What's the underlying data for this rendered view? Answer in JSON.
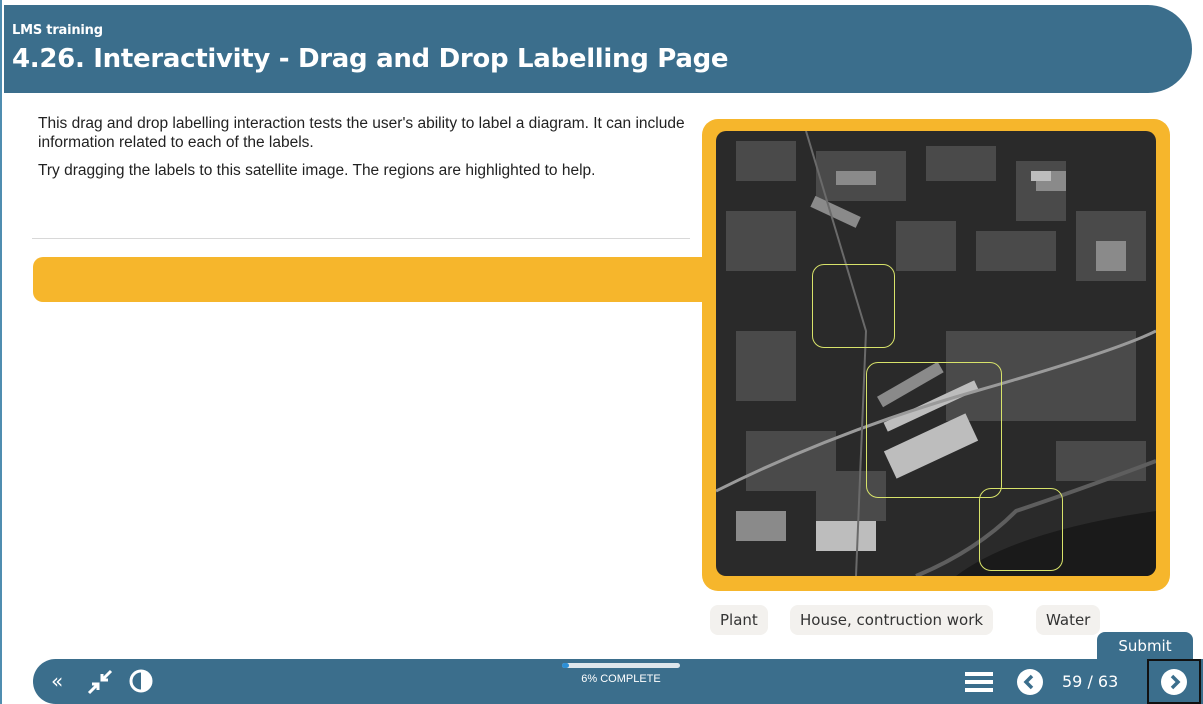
{
  "header": {
    "course": "LMS training",
    "title": "4.26. Interactivity - Drag and Drop Labelling Page"
  },
  "intro": {
    "paragraph1": "This drag and drop labelling interaction tests the user's ability to label a diagram. It can include information related to each of the labels.",
    "paragraph2": "Try dragging the labels to this satellite image. The regions are highlighted to help."
  },
  "labels": [
    "Plant",
    "House, contruction work",
    "Water"
  ],
  "submit_label": "Submit",
  "footer": {
    "icons": [
      "double-chevron-left-icon",
      "collapse-icon",
      "contrast-icon",
      "menu-icon",
      "previous-icon",
      "next-icon"
    ],
    "progress_text": "6% COMPLETE",
    "progress_value": 0.06,
    "page_indicator": "59 / 63"
  },
  "colors": {
    "header_bg": "#3b6e8c",
    "accent": "#f6b62c",
    "region_outline": "#d8e36a",
    "progress_fill": "#2c8fd6"
  }
}
